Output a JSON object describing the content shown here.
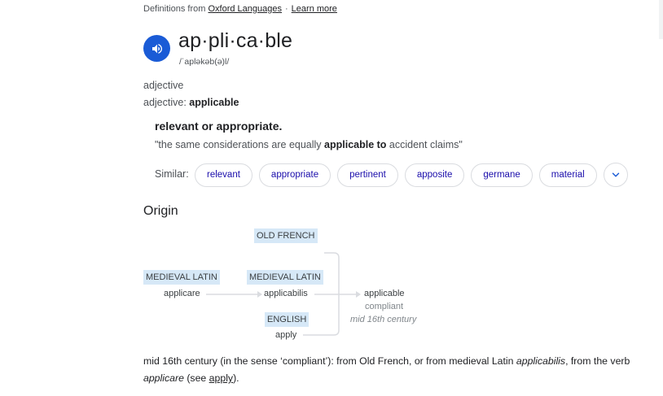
{
  "source": {
    "prefix": "Definitions from",
    "link_label": "Oxford Languages",
    "separator": "·",
    "learn_more": "Learn more"
  },
  "entry": {
    "headword": "ap·pli·ca·ble",
    "phonetic": "/ˈapləkəb(ə)l/",
    "pos": "adjective",
    "pos_form_prefix": "adjective:",
    "pos_form_word": "applicable"
  },
  "sense": {
    "definition": "relevant or appropriate.",
    "example_before": "\"the same considerations are equally ",
    "example_bold": "applicable to",
    "example_after": " accident claims\""
  },
  "similar": {
    "label": "Similar:",
    "chips": [
      "relevant",
      "appropriate",
      "pertinent",
      "apposite",
      "germane",
      "material"
    ]
  },
  "origin": {
    "title": "Origin",
    "diagram": {
      "old_french_tag": "OLD FRENCH",
      "medieval_latin_tag_1": "MEDIEVAL LATIN",
      "medieval_latin_tag_2": "MEDIEVAL LATIN",
      "english_tag": "ENGLISH",
      "word_applicare": "applicare",
      "word_applicabilis": "applicabilis",
      "word_apply": "apply",
      "result_word": "applicable",
      "result_sense": "compliant",
      "result_date": "mid 16th century"
    },
    "text": {
      "part1": "mid 16th century (in the sense ‘compliant’): from Old French, or from medieval Latin ",
      "italic1": "applicabilis",
      "part2": ", from the verb ",
      "italic2": "applicare",
      "part3": " (see ",
      "link": "apply",
      "part4": ")."
    }
  },
  "colors": {
    "speaker_button": "#1a5bd6",
    "chip_text": "#1a0dab",
    "tag_background": "#d6e8f7"
  },
  "icons": {
    "speaker": "speaker-icon",
    "expand": "chevron-down-icon",
    "arrow": "arrow-right-icon"
  }
}
